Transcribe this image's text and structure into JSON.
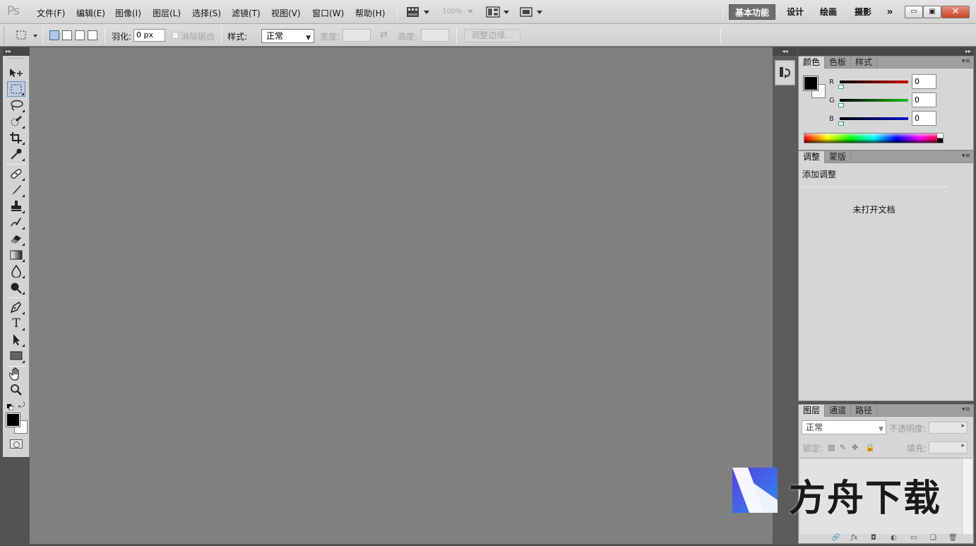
{
  "app": {
    "logo": "Ps",
    "menu": [
      "文件(F)",
      "编辑(E)",
      "图像(I)",
      "图层(L)",
      "选择(S)",
      "滤镜(T)",
      "视图(V)",
      "窗口(W)",
      "帮助(H)"
    ],
    "zoom": "100%",
    "workspaces": [
      "基本功能",
      "设计",
      "绘画",
      "摄影"
    ],
    "more_workspaces": "»",
    "window_controls": {
      "minimize": "▭",
      "maximize": "▣",
      "close": "✕"
    }
  },
  "options_bar": {
    "feather_label": "羽化:",
    "feather_value": "0 px",
    "antialias_label": "消除锯齿",
    "style_label": "样式:",
    "style_value": "正常",
    "width_label": "宽度:",
    "swap_icon": "⇄",
    "height_label": "高度:",
    "refine_edge_label": "调整边缘..."
  },
  "tools": [
    {
      "name": "move-tool",
      "glyph": "▸✥"
    },
    {
      "name": "rectangular-marquee-tool",
      "glyph": "⬚",
      "active": true
    },
    {
      "name": "lasso-tool",
      "glyph": "◯"
    },
    {
      "name": "quick-selection-tool",
      "glyph": "✎"
    },
    {
      "name": "crop-tool",
      "glyph": "⌗"
    },
    {
      "name": "eyedropper-tool",
      "glyph": "✒"
    },
    {
      "name": "spot-healing-brush-tool",
      "glyph": "✚"
    },
    {
      "name": "brush-tool",
      "glyph": "✏"
    },
    {
      "name": "clone-stamp-tool",
      "glyph": "♜"
    },
    {
      "name": "history-brush-tool",
      "glyph": "✍"
    },
    {
      "name": "eraser-tool",
      "glyph": "▰"
    },
    {
      "name": "gradient-tool",
      "glyph": "▤"
    },
    {
      "name": "blur-tool",
      "glyph": "💧"
    },
    {
      "name": "dodge-tool",
      "glyph": "●"
    },
    {
      "name": "pen-tool",
      "glyph": "✑"
    },
    {
      "name": "type-tool",
      "glyph": "T"
    },
    {
      "name": "path-selection-tool",
      "glyph": "➤"
    },
    {
      "name": "rectangle-tool",
      "glyph": "▭"
    },
    {
      "name": "hand-tool",
      "glyph": "✋"
    },
    {
      "name": "zoom-tool",
      "glyph": "🔍"
    }
  ],
  "colors": {
    "foreground": "#000000",
    "background": "#ffffff"
  },
  "color_panel": {
    "tabs": [
      "颜色",
      "色板",
      "样式"
    ],
    "channels": [
      {
        "label": "R",
        "value": "0",
        "color": "#d40000"
      },
      {
        "label": "G",
        "value": "0",
        "color": "#17c217"
      },
      {
        "label": "B",
        "value": "0",
        "color": "#0015d6"
      }
    ]
  },
  "adjustments_panel": {
    "tabs": [
      "调整",
      "蒙版"
    ],
    "title": "添加调整",
    "empty_message": "未打开文档"
  },
  "layers_panel": {
    "tabs": [
      "图层",
      "通道",
      "路径"
    ],
    "blend_mode": "正常",
    "opacity_label": "不透明度:",
    "lock_label": "锁定:",
    "fill_label": "填充:",
    "footer_icons": [
      "🔗",
      "fx",
      "◘",
      "◐",
      "▭",
      "❑",
      "🗑"
    ]
  },
  "watermark": {
    "text": "方舟下载"
  }
}
